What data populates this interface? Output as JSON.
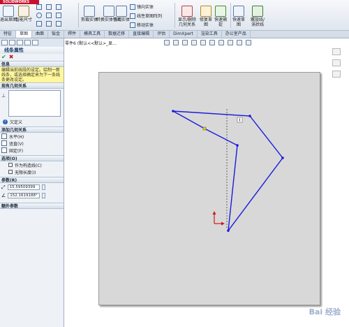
{
  "app": {
    "logo_text": "SOLIDWORKS"
  },
  "ribbon": {
    "buttons": [
      {
        "label": "退出草图"
      },
      {
        "label": "智能尺寸"
      },
      {
        "label": "剪裁实体"
      },
      {
        "label": "转换实体引用"
      },
      {
        "label": "等距实体"
      },
      {
        "label": "显示/删除几何关系"
      },
      {
        "label": "修复草图"
      },
      {
        "label": "快速捕捉"
      },
      {
        "label": "快速草图"
      },
      {
        "label": "螺旋线/涡状线"
      }
    ],
    "small_cmds": [
      {
        "label": "镜向实体"
      },
      {
        "label": "线性草图阵列"
      },
      {
        "label": "移动实体"
      }
    ]
  },
  "tabs": [
    "特征",
    "草图",
    "曲面",
    "钣金",
    "焊件",
    "模具工具",
    "数据迁移",
    "直接编辑",
    "评估",
    "DimXpert",
    "渲染工具",
    "办公室产品"
  ],
  "active_tab": 1,
  "panel": {
    "title": "线条属性",
    "info_header": "信息",
    "info_text": "编辑当前线段的设定。绘制一新线条，或选择确定来为下一条线条更改设定。",
    "existing_rel_header": "现有几何关系",
    "status_text": "欠定义",
    "add_rel_header": "添加几何关系",
    "add_rel_items": [
      "水平(H)",
      "竖直(V)",
      "固定(F)"
    ],
    "options_header": "选项(O)",
    "options": [
      "作为构造线(C)",
      "无限长度(I)"
    ],
    "params_header": "参数(R)",
    "length_value": "15.59509399",
    "angle_value": "152.1619188°",
    "extra_header": "额外参数"
  },
  "graphics": {
    "crumb": "零件6 (默认<<默认>_显...",
    "watermark": "Bai 经验"
  },
  "colors": {
    "sketch_line": "#1a1adb",
    "origin": "#d01818",
    "ribbon_accent": "#1b3a66"
  }
}
